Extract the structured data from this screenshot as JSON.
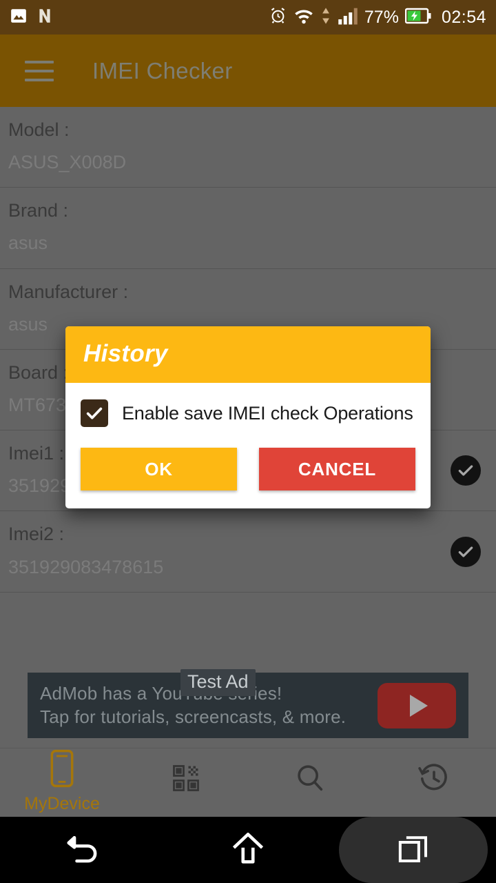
{
  "statusbar": {
    "icons_left": [
      "photo-icon",
      "nougat-icon"
    ],
    "icons_right": [
      "alarm-icon",
      "wifi-icon",
      "data-transfer-icon",
      "signal-icon"
    ],
    "battery_percent": "77%",
    "battery_icon": "battery-charging-icon",
    "time": "02:54"
  },
  "appbar": {
    "menu_icon": "hamburger-menu-icon",
    "title": "IMEI Checker"
  },
  "list": [
    {
      "key": "Model :",
      "value": "ASUS_X008D",
      "badge": false
    },
    {
      "key": "Brand :",
      "value": "asus",
      "badge": false
    },
    {
      "key": "Manufacturer :",
      "value": "asus",
      "badge": false
    },
    {
      "key": "Board :",
      "value": "MT673",
      "badge": false
    },
    {
      "key": "Imei1 :",
      "value": "351929",
      "badge": true
    },
    {
      "key": "Imei2 :",
      "value": "351929083478615",
      "badge": true
    }
  ],
  "ad": {
    "badge": "Test Ad",
    "line1": "AdMob has a YouTube series!",
    "line2": "Tap for tutorials, screencasts, & more.",
    "play_icon": "youtube-play-icon"
  },
  "tabbar": [
    {
      "icon": "phone-icon",
      "label": "MyDevice",
      "active": true
    },
    {
      "icon": "qrcode-icon",
      "label": "",
      "active": false
    },
    {
      "icon": "search-icon",
      "label": "",
      "active": false
    },
    {
      "icon": "history-icon",
      "label": "",
      "active": false
    }
  ],
  "navbar": [
    {
      "icon": "back-icon"
    },
    {
      "icon": "home-icon"
    },
    {
      "icon": "recents-icon"
    }
  ],
  "dialog": {
    "title": "History",
    "checkbox_checked": true,
    "checkbox_label": "Enable save IMEI check Operations",
    "ok_label": "OK",
    "cancel_label": "CANCEL"
  },
  "colors": {
    "accent_amber": "#FDB813",
    "cancel_red": "#E04438",
    "appbar": "#7a5302",
    "statusbar": "#5c3d11",
    "scrim_background": "#646464",
    "tab_active": "#a5760a"
  }
}
